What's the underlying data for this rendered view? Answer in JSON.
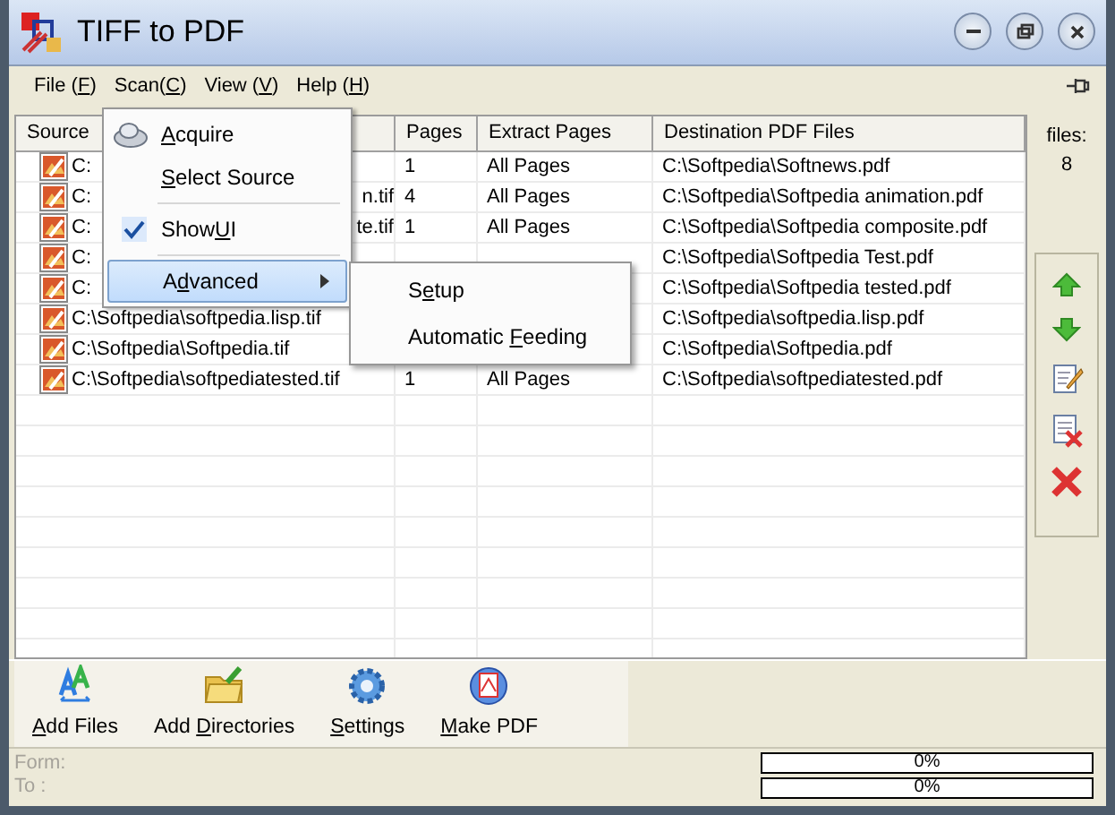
{
  "window": {
    "title": "TIFF to PDF"
  },
  "menu_bar": [
    {
      "before": "File (",
      "key": "F",
      "after": ")"
    },
    {
      "before": "Scan(",
      "key": "C",
      "after": ")"
    },
    {
      "before": "View (",
      "key": "V",
      "after": ")"
    },
    {
      "before": "Help (",
      "key": "H",
      "after": ")"
    }
  ],
  "table": {
    "columns": [
      "Source",
      "Pages",
      "Extract Pages",
      "Destination PDF Files"
    ],
    "rows": [
      {
        "source_file": "C:",
        "pages": "1",
        "extract_pages": "All Pages",
        "destination": "C:\\Softpedia\\Softnews.pdf"
      },
      {
        "source_file": "C:",
        "source_file_tail": "n.tif",
        "pages": "4",
        "extract_pages": "All Pages",
        "destination": "C:\\Softpedia\\Softpedia animation.pdf"
      },
      {
        "source_file": "C:",
        "source_file_tail": "te.tif",
        "pages": "1",
        "extract_pages": "All Pages",
        "destination": "C:\\Softpedia\\Softpedia composite.pdf"
      },
      {
        "source_file": "C:",
        "destination": "C:\\Softpedia\\Softpedia Test.pdf"
      },
      {
        "source_file": "C:",
        "destination": "C:\\Softpedia\\Softpedia tested.pdf"
      },
      {
        "source_file": "C:\\Softpedia\\softpedia.lisp.tif",
        "destination": "C:\\Softpedia\\softpedia.lisp.pdf"
      },
      {
        "source_file": "C:\\Softpedia\\Softpedia.tif",
        "destination": "C:\\Softpedia\\Softpedia.pdf"
      },
      {
        "source_file": "C:\\Softpedia\\softpediatested.tif",
        "pages": "1",
        "extract_pages": "All Pages",
        "destination": "C:\\Softpedia\\softpediatested.pdf"
      }
    ]
  },
  "files_count": {
    "label": "files:",
    "value": "8"
  },
  "toolbar": [
    {
      "kind": "add-files",
      "key": "A",
      "after": "dd Files"
    },
    {
      "kind": "add-directories",
      "before": "Add ",
      "key": "D",
      "after": "irectories"
    },
    {
      "kind": "settings",
      "key": "S",
      "after": "ettings"
    },
    {
      "kind": "make-pdf",
      "key": "M",
      "after": "ake PDF"
    }
  ],
  "status": [
    {
      "label": "Form:",
      "reading": "0%",
      "level": 0
    },
    {
      "label": "To :",
      "reading": "0%",
      "level": 0
    }
  ],
  "scan_menu": {
    "items": [
      {
        "kind": "item",
        "icon": true,
        "key": "A",
        "after": "cquire",
        "checked": false,
        "selected": false
      },
      {
        "kind": "item",
        "icon": false,
        "key": "S",
        "after": "elect Source",
        "checked": false,
        "selected": false
      },
      {
        "kind": "separator"
      },
      {
        "kind": "item",
        "icon": false,
        "before": "Show",
        "key": "U",
        "after": "I",
        "checked": true,
        "selected": false
      },
      {
        "kind": "separator"
      },
      {
        "kind": "submenu",
        "icon": false,
        "before": "A",
        "key": "d",
        "after": "vanced",
        "checked": false,
        "selected": true
      }
    ],
    "submenu": [
      {
        "before": "S",
        "key": "e",
        "after": "tup"
      },
      {
        "before": "Automatic ",
        "key": "F",
        "after": "eeding"
      }
    ]
  }
}
